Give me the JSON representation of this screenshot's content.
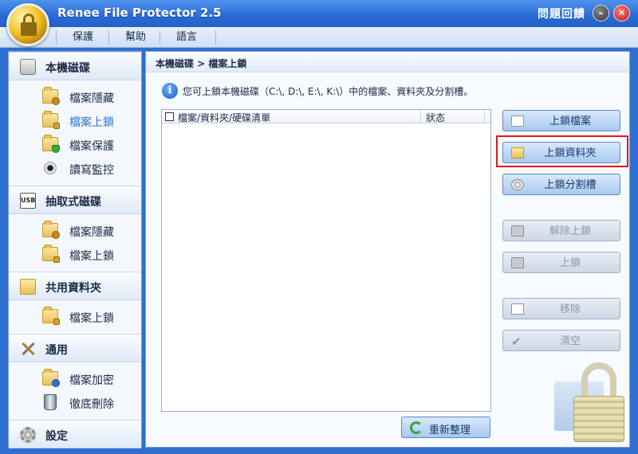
{
  "app": {
    "title": "Renee File Protector 2.5",
    "feedback": "問題回饋",
    "minimize_glyph": "–",
    "close_glyph": "✕"
  },
  "menu": {
    "items": [
      {
        "label": "保護"
      },
      {
        "label": "幫助"
      },
      {
        "label": "語言"
      }
    ]
  },
  "sidebar": {
    "sections": [
      {
        "label": "本機磁碟",
        "icon": "hard-disk-icon",
        "items": [
          {
            "label": "檔案隱藏",
            "icon": "folder-hide-icon"
          },
          {
            "label": "檔案上鎖",
            "icon": "folder-lock-icon",
            "active": true
          },
          {
            "label": "檔案保護",
            "icon": "folder-shield-icon"
          },
          {
            "label": "讀寫監控",
            "icon": "monitor-icon"
          }
        ]
      },
      {
        "label": "抽取式磁碟",
        "icon": "usb-icon",
        "icon_text": "USB",
        "items": [
          {
            "label": "檔案隱藏",
            "icon": "folder-hide-icon"
          },
          {
            "label": "檔案上鎖",
            "icon": "folder-lock-icon"
          }
        ]
      },
      {
        "label": "共用資料夾",
        "icon": "shared-folder-icon",
        "items": [
          {
            "label": "檔案上鎖",
            "icon": "folder-lock-icon"
          }
        ]
      },
      {
        "label": "通用",
        "icon": "tools-icon",
        "items": [
          {
            "label": "檔案加密",
            "icon": "folder-encrypt-icon"
          },
          {
            "label": "徹底刪除",
            "icon": "trash-icon"
          }
        ]
      },
      {
        "label": "設定",
        "icon": "gear-icon",
        "items": []
      }
    ]
  },
  "main": {
    "breadcrumb": "本機磁碟 > 檔案上鎖",
    "info": "您可上鎖本機磁碟（C:\\, D:\\, E:\\, K:\\）中的檔案、資料夾及分割槽。",
    "info_glyph": "i",
    "list": {
      "columns": [
        "檔案/資料夾/硬碟清單",
        "狀态"
      ]
    },
    "actions": [
      {
        "label": "上鎖檔案",
        "icon": "file-icon",
        "enabled": true
      },
      {
        "label": "上鎖資料夾",
        "icon": "folder-icon",
        "enabled": true,
        "highlighted": true
      },
      {
        "label": "上鎖分割槽",
        "icon": "disc-icon",
        "enabled": true
      },
      {
        "label": "解除上鎖",
        "icon": "unlock-icon",
        "enabled": false
      },
      {
        "label": "上鎖",
        "icon": "lock-icon",
        "enabled": false
      },
      {
        "label": "移除",
        "icon": "remove-icon",
        "enabled": false
      },
      {
        "label": "清空",
        "icon": "check-icon",
        "enabled": false
      }
    ],
    "refresh": "重新整理"
  },
  "colors": {
    "title_bar": "#2a6ad6",
    "accent": "#2d72d2",
    "highlight_border": "#e01a1a"
  }
}
